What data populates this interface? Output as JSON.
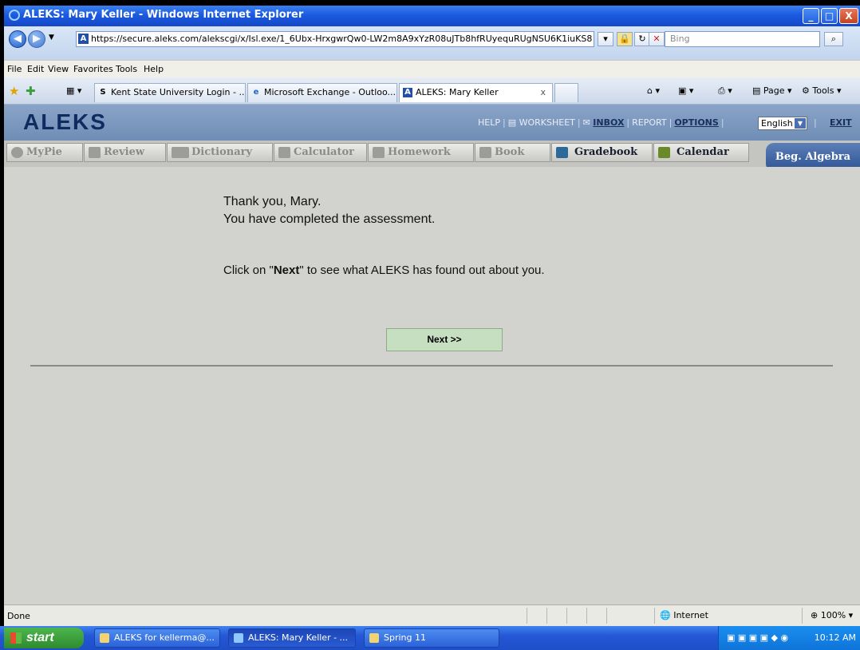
{
  "window": {
    "title": "ALEKS: Mary Keller - Windows Internet Explorer"
  },
  "address_bar": {
    "url": "https://secure.aleks.com/alekscgi/x/Isl.exe/1_6Ubx-HrxgwrQw0-LW2m8A9xYzR08uJTb8hfRUyequRUgNSU6K1iuKS8",
    "search_placeholder": "Bing"
  },
  "menu": [
    "File",
    "Edit",
    "View",
    "Favorites",
    "Tools",
    "Help"
  ],
  "browser_tabs": [
    {
      "label": "Kent State University Login - ...",
      "icon": "S"
    },
    {
      "label": "Microsoft Exchange - Outloo...",
      "icon": "e"
    },
    {
      "label": "ALEKS: Mary Keller",
      "icon": "A"
    }
  ],
  "command_bar": {
    "page": "Page",
    "tools": "Tools"
  },
  "aleks": {
    "logo": "ALEKS",
    "links": {
      "help": "HELP",
      "worksheet": "WORKSHEET",
      "inbox": "INBOX",
      "report": "REPORT",
      "options": "OPTIONS",
      "exit": "EXIT"
    },
    "language": "English",
    "nav_tabs": [
      {
        "label": "MyPie",
        "active": false
      },
      {
        "label": "Review",
        "active": false
      },
      {
        "label": "Dictionary",
        "active": false
      },
      {
        "label": "Calculator",
        "active": false
      },
      {
        "label": "Homework",
        "active": false
      },
      {
        "label": "Book",
        "active": false
      },
      {
        "label": "Gradebook",
        "active": true
      },
      {
        "label": "Calendar",
        "active": true
      }
    ],
    "course": "Beg. Algebra"
  },
  "content": {
    "line1": "Thank you, Mary.",
    "line2": "You have completed the assessment.",
    "instruction_prefix": "Click on \"",
    "instruction_bold": "Next",
    "instruction_suffix": "\" to see what ALEKS has found out about you.",
    "next_button": "Next >>"
  },
  "status_bar": {
    "status": "Done",
    "zone": "Internet",
    "zoom": "100%"
  },
  "taskbar": {
    "start": "start",
    "items": [
      "ALEKS for kellerma@...",
      "ALEKS: Mary Keller - ...",
      "Spring 11"
    ],
    "clock": "10:12 AM"
  }
}
